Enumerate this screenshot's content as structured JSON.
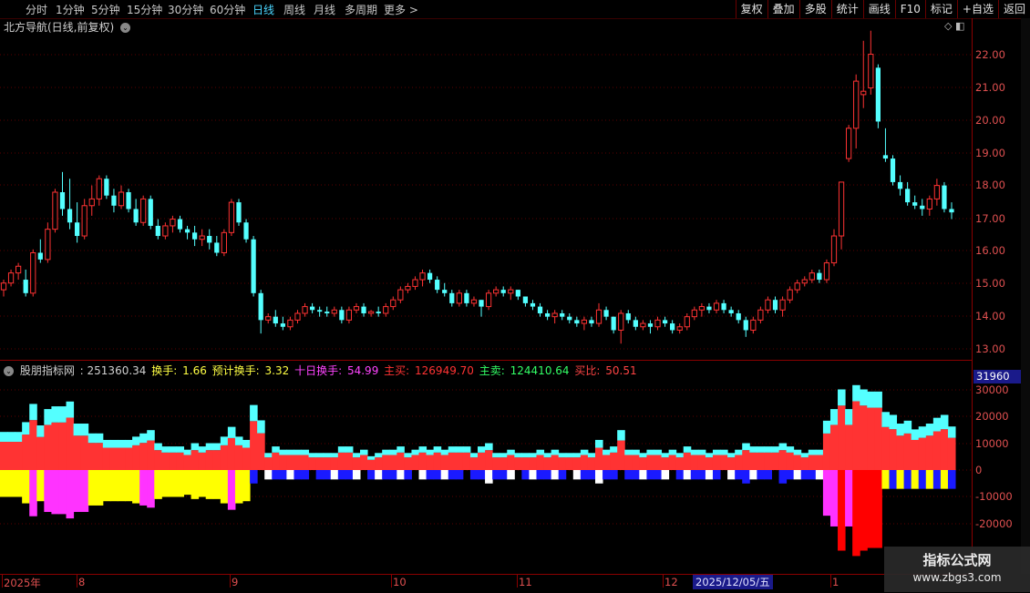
{
  "toolbar": {
    "periods": [
      "分时",
      "1分钟",
      "5分钟",
      "15分钟",
      "30分钟",
      "60分钟",
      "日线",
      "周线",
      "月线",
      "多周期",
      "更多 >"
    ],
    "active_index": 6,
    "right_buttons": [
      "复权",
      "叠加",
      "多股",
      "统计",
      "画线",
      "F10",
      "标记",
      "+自选",
      "返回"
    ]
  },
  "main": {
    "title": "北方导航(日线,前复权)",
    "yticks": [
      "22.00",
      "21.00",
      "20.00",
      "19.00",
      "18.00",
      "17.00",
      "16.00",
      "15.00",
      "14.00",
      "13.00"
    ]
  },
  "indicator": {
    "name": "股朋指标网",
    "value": ": 251360.34",
    "turnover_label": "换手:",
    "turnover": "1.66",
    "est_label": "预计换手:",
    "est": "3.32",
    "ten_label": "十日换手:",
    "ten": "54.99",
    "buy_label": "主买:",
    "buy": "126949.70",
    "sell_label": "主卖:",
    "sell": "124410.64",
    "ratio_label": "买比:",
    "ratio": "50.51",
    "highlight": "31960",
    "yticks": [
      "30000",
      "20000",
      "10000",
      "0",
      "-10000",
      "-20000"
    ]
  },
  "bottom_axis": {
    "labels": [
      "2025年",
      "8",
      "9",
      "10",
      "11",
      "12",
      "1"
    ],
    "current_date": "2025/12/05/五"
  },
  "watermark": {
    "line1": "指标公式网",
    "line2": "www.zbgs3.com"
  },
  "colors": {
    "up": "#ff3333",
    "down": "#54ffff",
    "yellow": "#ffff00",
    "magenta": "#ff33ff",
    "blue": "#1a1aff",
    "white": "#ffffff"
  },
  "chart_data": {
    "type": "candlestick",
    "y_range": [
      12.8,
      22.6
    ],
    "candles": [
      [
        14.8,
        15.1,
        14.6,
        15.0
      ],
      [
        15.0,
        15.4,
        14.9,
        15.3
      ],
      [
        15.3,
        15.6,
        15.1,
        15.5
      ],
      [
        15.1,
        15.4,
        14.6,
        14.7
      ],
      [
        14.7,
        16.0,
        14.6,
        15.9
      ],
      [
        15.9,
        16.3,
        15.6,
        15.7
      ],
      [
        15.7,
        16.8,
        15.6,
        16.6
      ],
      [
        16.6,
        17.8,
        16.5,
        17.7
      ],
      [
        17.7,
        18.3,
        17.0,
        17.2
      ],
      [
        17.2,
        18.1,
        16.6,
        16.8
      ],
      [
        16.8,
        17.4,
        16.2,
        16.4
      ],
      [
        16.4,
        17.5,
        16.3,
        17.3
      ],
      [
        17.3,
        17.9,
        17.0,
        17.5
      ],
      [
        17.5,
        18.2,
        17.3,
        18.1
      ],
      [
        18.1,
        18.2,
        17.5,
        17.6
      ],
      [
        17.6,
        17.8,
        17.1,
        17.3
      ],
      [
        17.3,
        17.9,
        17.2,
        17.7
      ],
      [
        17.7,
        17.8,
        17.1,
        17.2
      ],
      [
        17.2,
        17.5,
        16.7,
        16.8
      ],
      [
        16.8,
        17.6,
        16.7,
        17.5
      ],
      [
        17.5,
        17.6,
        16.6,
        16.7
      ],
      [
        16.7,
        16.9,
        16.3,
        16.4
      ],
      [
        16.4,
        16.8,
        16.3,
        16.7
      ],
      [
        16.7,
        17.0,
        16.5,
        16.9
      ],
      [
        16.9,
        17.0,
        16.5,
        16.6
      ],
      [
        16.6,
        16.7,
        16.3,
        16.5
      ],
      [
        16.5,
        16.7,
        16.1,
        16.3
      ],
      [
        16.3,
        16.6,
        16.1,
        16.4
      ],
      [
        16.4,
        16.6,
        16.0,
        16.2
      ],
      [
        16.2,
        16.4,
        15.8,
        15.9
      ],
      [
        15.9,
        16.6,
        15.8,
        16.5
      ],
      [
        16.5,
        17.5,
        16.4,
        17.4
      ],
      [
        17.4,
        17.5,
        16.7,
        16.8
      ],
      [
        16.8,
        16.9,
        16.2,
        16.3
      ],
      [
        16.3,
        16.4,
        14.6,
        14.7
      ],
      [
        14.7,
        14.8,
        13.5,
        13.9
      ],
      [
        13.9,
        14.1,
        13.8,
        14.0
      ],
      [
        14.0,
        14.2,
        13.7,
        13.8
      ],
      [
        13.8,
        14.0,
        13.6,
        13.7
      ],
      [
        13.7,
        14.0,
        13.6,
        13.9
      ],
      [
        13.9,
        14.2,
        13.8,
        14.1
      ],
      [
        14.1,
        14.4,
        14.0,
        14.3
      ],
      [
        14.3,
        14.4,
        14.1,
        14.2
      ],
      [
        14.2,
        14.3,
        14.0,
        14.15
      ],
      [
        14.15,
        14.3,
        14.0,
        14.1
      ],
      [
        14.1,
        14.3,
        14.0,
        14.2
      ],
      [
        14.2,
        14.3,
        13.8,
        13.9
      ],
      [
        13.9,
        14.3,
        13.8,
        14.2
      ],
      [
        14.2,
        14.4,
        14.1,
        14.3
      ],
      [
        14.3,
        14.4,
        14.0,
        14.1
      ],
      [
        14.1,
        14.2,
        14.0,
        14.15
      ],
      [
        14.15,
        14.3,
        14.0,
        14.1
      ],
      [
        14.1,
        14.4,
        14.0,
        14.3
      ],
      [
        14.3,
        14.6,
        14.2,
        14.5
      ],
      [
        14.5,
        14.9,
        14.4,
        14.8
      ],
      [
        14.8,
        15.0,
        14.7,
        14.9
      ],
      [
        14.9,
        15.2,
        14.8,
        15.1
      ],
      [
        15.1,
        15.4,
        14.9,
        15.3
      ],
      [
        15.3,
        15.4,
        15.0,
        15.1
      ],
      [
        15.1,
        15.2,
        14.7,
        14.8
      ],
      [
        14.8,
        15.0,
        14.6,
        14.7
      ],
      [
        14.7,
        14.8,
        14.3,
        14.4
      ],
      [
        14.4,
        14.8,
        14.3,
        14.7
      ],
      [
        14.7,
        14.8,
        14.3,
        14.4
      ],
      [
        14.4,
        14.6,
        14.3,
        14.5
      ],
      [
        14.5,
        14.5,
        14.0,
        14.3
      ],
      [
        14.3,
        14.8,
        14.2,
        14.7
      ],
      [
        14.7,
        14.9,
        14.6,
        14.8
      ],
      [
        14.8,
        14.9,
        14.6,
        14.7
      ],
      [
        14.7,
        14.9,
        14.5,
        14.8
      ],
      [
        14.8,
        14.8,
        14.5,
        14.6
      ],
      [
        14.6,
        14.6,
        14.3,
        14.4
      ],
      [
        14.4,
        14.5,
        14.2,
        14.3
      ],
      [
        14.3,
        14.4,
        14.0,
        14.1
      ],
      [
        14.1,
        14.2,
        13.9,
        14.0
      ],
      [
        14.0,
        14.2,
        13.8,
        14.1
      ],
      [
        14.1,
        14.2,
        13.9,
        14.0
      ],
      [
        14.0,
        14.1,
        13.8,
        13.9
      ],
      [
        13.9,
        14.0,
        13.7,
        13.8
      ],
      [
        13.8,
        14.0,
        13.6,
        13.9
      ],
      [
        13.9,
        14.0,
        13.7,
        13.8
      ],
      [
        13.8,
        14.4,
        13.7,
        14.2
      ],
      [
        14.2,
        14.3,
        13.9,
        14.0
      ],
      [
        14.0,
        14.0,
        13.5,
        13.6
      ],
      [
        13.6,
        14.2,
        13.2,
        14.1
      ],
      [
        14.1,
        14.2,
        13.8,
        13.9
      ],
      [
        13.9,
        14.0,
        13.6,
        13.7
      ],
      [
        13.7,
        13.9,
        13.6,
        13.8
      ],
      [
        13.8,
        13.9,
        13.5,
        13.7
      ],
      [
        13.7,
        14.0,
        13.6,
        13.9
      ],
      [
        13.9,
        14.0,
        13.7,
        13.8
      ],
      [
        13.8,
        13.9,
        13.5,
        13.6
      ],
      [
        13.6,
        13.8,
        13.5,
        13.7
      ],
      [
        13.7,
        14.1,
        13.6,
        14.0
      ],
      [
        14.0,
        14.3,
        13.9,
        14.2
      ],
      [
        14.2,
        14.4,
        14.0,
        14.3
      ],
      [
        14.3,
        14.4,
        14.1,
        14.2
      ],
      [
        14.2,
        14.5,
        14.1,
        14.4
      ],
      [
        14.4,
        14.5,
        14.1,
        14.2
      ],
      [
        14.2,
        14.3,
        14.0,
        14.1
      ],
      [
        14.1,
        14.2,
        13.8,
        13.9
      ],
      [
        13.9,
        14.0,
        13.4,
        13.6
      ],
      [
        13.6,
        14.0,
        13.5,
        13.9
      ],
      [
        13.9,
        14.3,
        13.8,
        14.2
      ],
      [
        14.2,
        14.6,
        14.1,
        14.5
      ],
      [
        14.5,
        14.6,
        14.1,
        14.2
      ],
      [
        14.2,
        14.6,
        14.0,
        14.5
      ],
      [
        14.5,
        14.9,
        14.4,
        14.8
      ],
      [
        14.8,
        15.1,
        14.7,
        15.0
      ],
      [
        15.0,
        15.2,
        14.9,
        15.1
      ],
      [
        15.1,
        15.4,
        15.0,
        15.3
      ],
      [
        15.3,
        15.4,
        15.0,
        15.1
      ],
      [
        15.1,
        15.7,
        15.0,
        15.6
      ],
      [
        15.6,
        16.6,
        15.5,
        16.4
      ],
      [
        16.4,
        18.0,
        16.0,
        18.0
      ],
      [
        18.7,
        19.7,
        18.6,
        19.6
      ],
      [
        19.6,
        21.2,
        19.0,
        21.0
      ],
      [
        20.6,
        22.2,
        20.2,
        20.7
      ],
      [
        20.8,
        22.5,
        20.6,
        21.8
      ],
      [
        21.4,
        21.5,
        19.6,
        19.8
      ],
      [
        18.8,
        19.6,
        18.6,
        18.7
      ],
      [
        18.7,
        18.8,
        17.9,
        18.0
      ],
      [
        18.0,
        18.2,
        17.6,
        17.8
      ],
      [
        17.8,
        18.0,
        17.3,
        17.4
      ],
      [
        17.4,
        17.6,
        17.2,
        17.3
      ],
      [
        17.3,
        17.5,
        17.0,
        17.2
      ],
      [
        17.2,
        17.6,
        17.0,
        17.5
      ],
      [
        17.5,
        18.1,
        17.3,
        17.9
      ],
      [
        17.9,
        18.0,
        17.1,
        17.2
      ],
      [
        17.2,
        17.4,
        16.9,
        17.1
      ]
    ]
  }
}
